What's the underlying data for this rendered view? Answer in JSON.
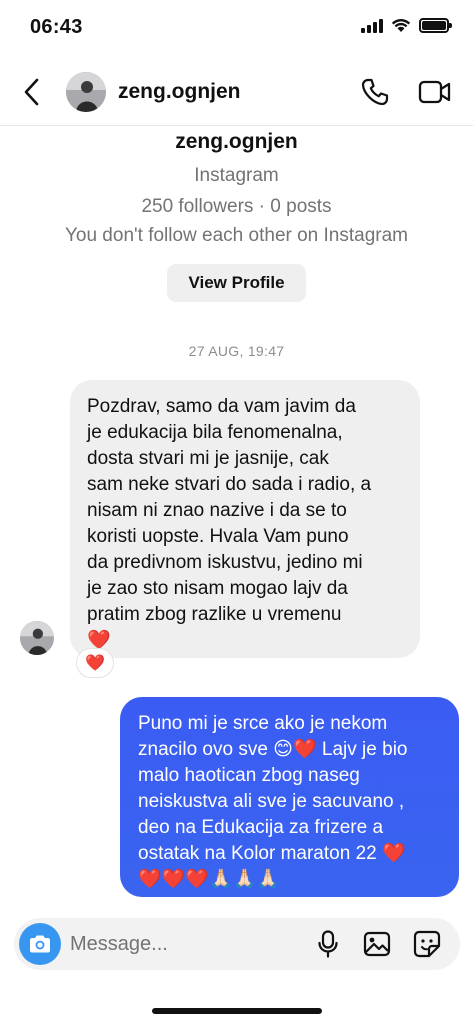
{
  "status_bar": {
    "time": "06:43"
  },
  "header": {
    "username": "zeng.ognjen"
  },
  "profile": {
    "name": "zeng.ognjen",
    "platform": "Instagram",
    "stats": "250 followers · 0 posts",
    "follow_status": "You don't follow each other on Instagram",
    "view_profile_label": "View Profile"
  },
  "timestamp": "27 AUG, 19:47",
  "messages": {
    "incoming": {
      "text": "Pozdrav, samo da vam javim da\nje edukacija bila fenomenalna,\ndosta stvari mi je jasnije, cak\nsam neke stvari do sada i radio, a\nnisam ni znao nazive i da se to\nkoristi uopste. Hvala Vam puno\nda predivnom iskustvu, jedino mi\nje zao sto nisam mogao lajv da\npratim zbog razlike u vremenu\n❤️",
      "reaction": "❤️"
    },
    "outgoing": {
      "text": "Puno mi je srce ako je nekom\nznacilo ovo sve 😊❤️ Lajv je bio\nmalo haotican zbog naseg\nneiskustva ali sve je sacuvano ,\ndeo na Edukacija za frizere a\nostatak na Kolor maraton 22 ❤️\n❤️❤️❤️🙏🏻🙏🏻🙏🏻"
    }
  },
  "composer": {
    "placeholder": "Message..."
  },
  "icons": {
    "back": "chevron-left-icon",
    "call": "phone-icon",
    "video": "video-camera-icon",
    "camera": "camera-icon",
    "mic": "microphone-icon",
    "gallery": "image-icon",
    "sticker": "sticker-icon"
  },
  "colors": {
    "outgoing_bubble": "#3b5cf3",
    "incoming_bubble": "#efefef",
    "camera_button": "#3797f0",
    "secondary_text": "#737373"
  }
}
